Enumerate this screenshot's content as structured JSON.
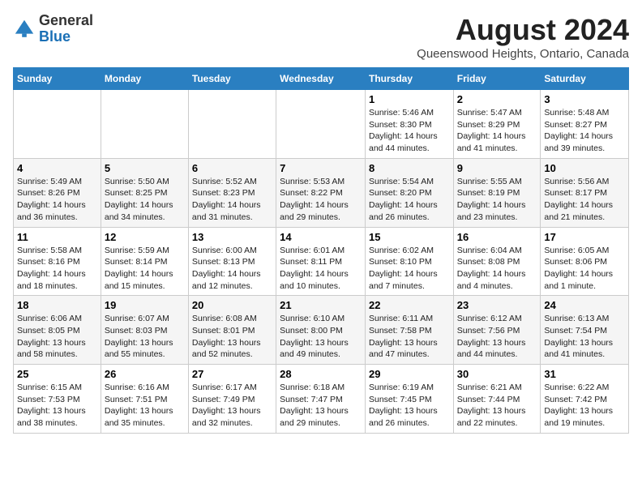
{
  "header": {
    "logo_general": "General",
    "logo_blue": "Blue",
    "month_year": "August 2024",
    "location": "Queenswood Heights, Ontario, Canada"
  },
  "weekdays": [
    "Sunday",
    "Monday",
    "Tuesday",
    "Wednesday",
    "Thursday",
    "Friday",
    "Saturday"
  ],
  "weeks": [
    [
      {
        "day": "",
        "info": ""
      },
      {
        "day": "",
        "info": ""
      },
      {
        "day": "",
        "info": ""
      },
      {
        "day": "",
        "info": ""
      },
      {
        "day": "1",
        "info": "Sunrise: 5:46 AM\nSunset: 8:30 PM\nDaylight: 14 hours\nand 44 minutes."
      },
      {
        "day": "2",
        "info": "Sunrise: 5:47 AM\nSunset: 8:29 PM\nDaylight: 14 hours\nand 41 minutes."
      },
      {
        "day": "3",
        "info": "Sunrise: 5:48 AM\nSunset: 8:27 PM\nDaylight: 14 hours\nand 39 minutes."
      }
    ],
    [
      {
        "day": "4",
        "info": "Sunrise: 5:49 AM\nSunset: 8:26 PM\nDaylight: 14 hours\nand 36 minutes."
      },
      {
        "day": "5",
        "info": "Sunrise: 5:50 AM\nSunset: 8:25 PM\nDaylight: 14 hours\nand 34 minutes."
      },
      {
        "day": "6",
        "info": "Sunrise: 5:52 AM\nSunset: 8:23 PM\nDaylight: 14 hours\nand 31 minutes."
      },
      {
        "day": "7",
        "info": "Sunrise: 5:53 AM\nSunset: 8:22 PM\nDaylight: 14 hours\nand 29 minutes."
      },
      {
        "day": "8",
        "info": "Sunrise: 5:54 AM\nSunset: 8:20 PM\nDaylight: 14 hours\nand 26 minutes."
      },
      {
        "day": "9",
        "info": "Sunrise: 5:55 AM\nSunset: 8:19 PM\nDaylight: 14 hours\nand 23 minutes."
      },
      {
        "day": "10",
        "info": "Sunrise: 5:56 AM\nSunset: 8:17 PM\nDaylight: 14 hours\nand 21 minutes."
      }
    ],
    [
      {
        "day": "11",
        "info": "Sunrise: 5:58 AM\nSunset: 8:16 PM\nDaylight: 14 hours\nand 18 minutes."
      },
      {
        "day": "12",
        "info": "Sunrise: 5:59 AM\nSunset: 8:14 PM\nDaylight: 14 hours\nand 15 minutes."
      },
      {
        "day": "13",
        "info": "Sunrise: 6:00 AM\nSunset: 8:13 PM\nDaylight: 14 hours\nand 12 minutes."
      },
      {
        "day": "14",
        "info": "Sunrise: 6:01 AM\nSunset: 8:11 PM\nDaylight: 14 hours\nand 10 minutes."
      },
      {
        "day": "15",
        "info": "Sunrise: 6:02 AM\nSunset: 8:10 PM\nDaylight: 14 hours\nand 7 minutes."
      },
      {
        "day": "16",
        "info": "Sunrise: 6:04 AM\nSunset: 8:08 PM\nDaylight: 14 hours\nand 4 minutes."
      },
      {
        "day": "17",
        "info": "Sunrise: 6:05 AM\nSunset: 8:06 PM\nDaylight: 14 hours\nand 1 minute."
      }
    ],
    [
      {
        "day": "18",
        "info": "Sunrise: 6:06 AM\nSunset: 8:05 PM\nDaylight: 13 hours\nand 58 minutes."
      },
      {
        "day": "19",
        "info": "Sunrise: 6:07 AM\nSunset: 8:03 PM\nDaylight: 13 hours\nand 55 minutes."
      },
      {
        "day": "20",
        "info": "Sunrise: 6:08 AM\nSunset: 8:01 PM\nDaylight: 13 hours\nand 52 minutes."
      },
      {
        "day": "21",
        "info": "Sunrise: 6:10 AM\nSunset: 8:00 PM\nDaylight: 13 hours\nand 49 minutes."
      },
      {
        "day": "22",
        "info": "Sunrise: 6:11 AM\nSunset: 7:58 PM\nDaylight: 13 hours\nand 47 minutes."
      },
      {
        "day": "23",
        "info": "Sunrise: 6:12 AM\nSunset: 7:56 PM\nDaylight: 13 hours\nand 44 minutes."
      },
      {
        "day": "24",
        "info": "Sunrise: 6:13 AM\nSunset: 7:54 PM\nDaylight: 13 hours\nand 41 minutes."
      }
    ],
    [
      {
        "day": "25",
        "info": "Sunrise: 6:15 AM\nSunset: 7:53 PM\nDaylight: 13 hours\nand 38 minutes."
      },
      {
        "day": "26",
        "info": "Sunrise: 6:16 AM\nSunset: 7:51 PM\nDaylight: 13 hours\nand 35 minutes."
      },
      {
        "day": "27",
        "info": "Sunrise: 6:17 AM\nSunset: 7:49 PM\nDaylight: 13 hours\nand 32 minutes."
      },
      {
        "day": "28",
        "info": "Sunrise: 6:18 AM\nSunset: 7:47 PM\nDaylight: 13 hours\nand 29 minutes."
      },
      {
        "day": "29",
        "info": "Sunrise: 6:19 AM\nSunset: 7:45 PM\nDaylight: 13 hours\nand 26 minutes."
      },
      {
        "day": "30",
        "info": "Sunrise: 6:21 AM\nSunset: 7:44 PM\nDaylight: 13 hours\nand 22 minutes."
      },
      {
        "day": "31",
        "info": "Sunrise: 6:22 AM\nSunset: 7:42 PM\nDaylight: 13 hours\nand 19 minutes."
      }
    ]
  ]
}
